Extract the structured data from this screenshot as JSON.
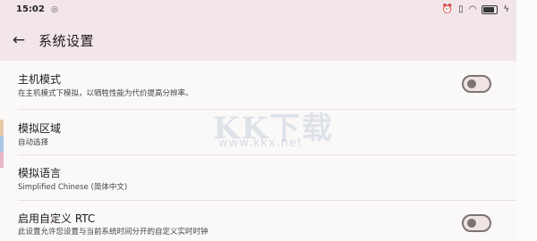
{
  "status_bar": {
    "time": "15:02",
    "icons": [
      "alarm-icon",
      "vibrate-icon",
      "wifi-icon",
      "battery-icon",
      "charging-icon"
    ]
  },
  "header": {
    "title": "系统设置"
  },
  "settings": [
    {
      "title": "主机模式",
      "subtitle": "在主机模式下模拟，以牺牲性能为代价提高分辨率。",
      "toggle": true,
      "enabled": false
    },
    {
      "title": "模拟区域",
      "subtitle": "自动选择",
      "toggle": false
    },
    {
      "title": "模拟语言",
      "subtitle": "Simplified Chinese (简体中文)",
      "toggle": false
    },
    {
      "title": "启用自定义 RTC",
      "subtitle": "此设置允许您设置与当前系统时间分开的自定义实时时钟",
      "toggle": true,
      "enabled": false
    }
  ],
  "watermark": {
    "logo": "KK下载",
    "url": "www.kkx.net"
  },
  "colors": {
    "header_bg": "#f2e6e8",
    "toggle_outline": "#7c7374",
    "toggle_track": "#efe3e4",
    "edge_strips": [
      "#e8c9a8",
      "#a9c8e6",
      "#e8b6c8"
    ]
  }
}
